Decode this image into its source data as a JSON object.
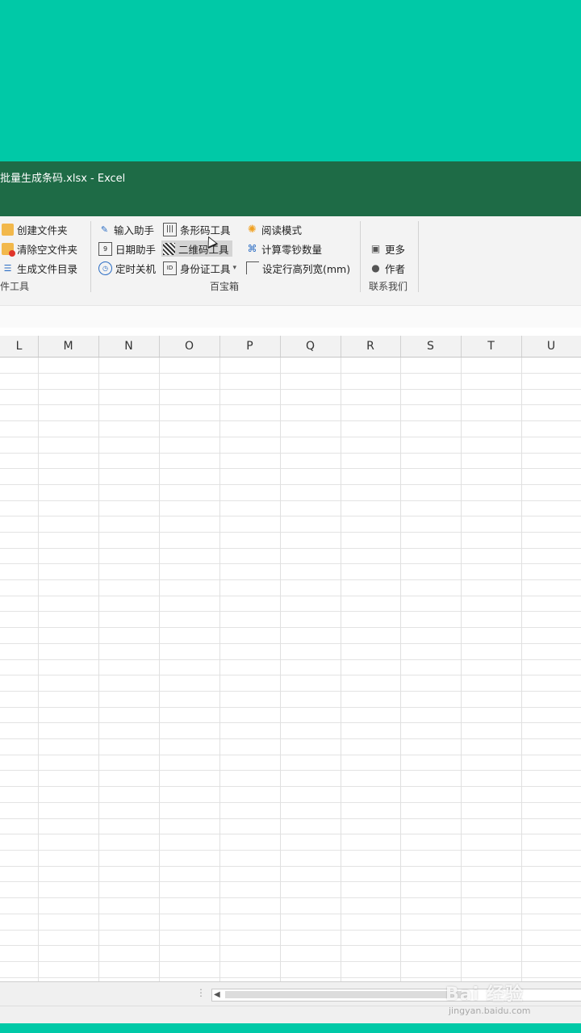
{
  "window": {
    "title": "批量生成条码.xlsx  -  Excel"
  },
  "ribbon": {
    "file_tools": {
      "items": [
        "创建文件夹",
        "清除空文件夹",
        "生成文件目录"
      ],
      "group_label": "件工具"
    },
    "baobao": {
      "col1": [
        "输入助手",
        "日期助手",
        "定时关机"
      ],
      "col2": [
        "条形码工具",
        "二维码工具",
        "身份证工具"
      ],
      "col3": [
        "阅读模式",
        "计算零钞数量",
        "设定行高列宽(mm)"
      ],
      "group_label": "百宝箱"
    },
    "contact": {
      "items": [
        "更多",
        "作者"
      ],
      "group_label": "联系我们"
    }
  },
  "grid": {
    "columns": [
      "L",
      "M",
      "N",
      "O",
      "P",
      "Q",
      "R",
      "S",
      "T",
      "U"
    ]
  },
  "watermark": {
    "text": "Bai 经验",
    "sub": "jingyan.baidu.com"
  },
  "colors": {
    "teal": "#00c9a7",
    "excel_green": "#1e6b46"
  }
}
